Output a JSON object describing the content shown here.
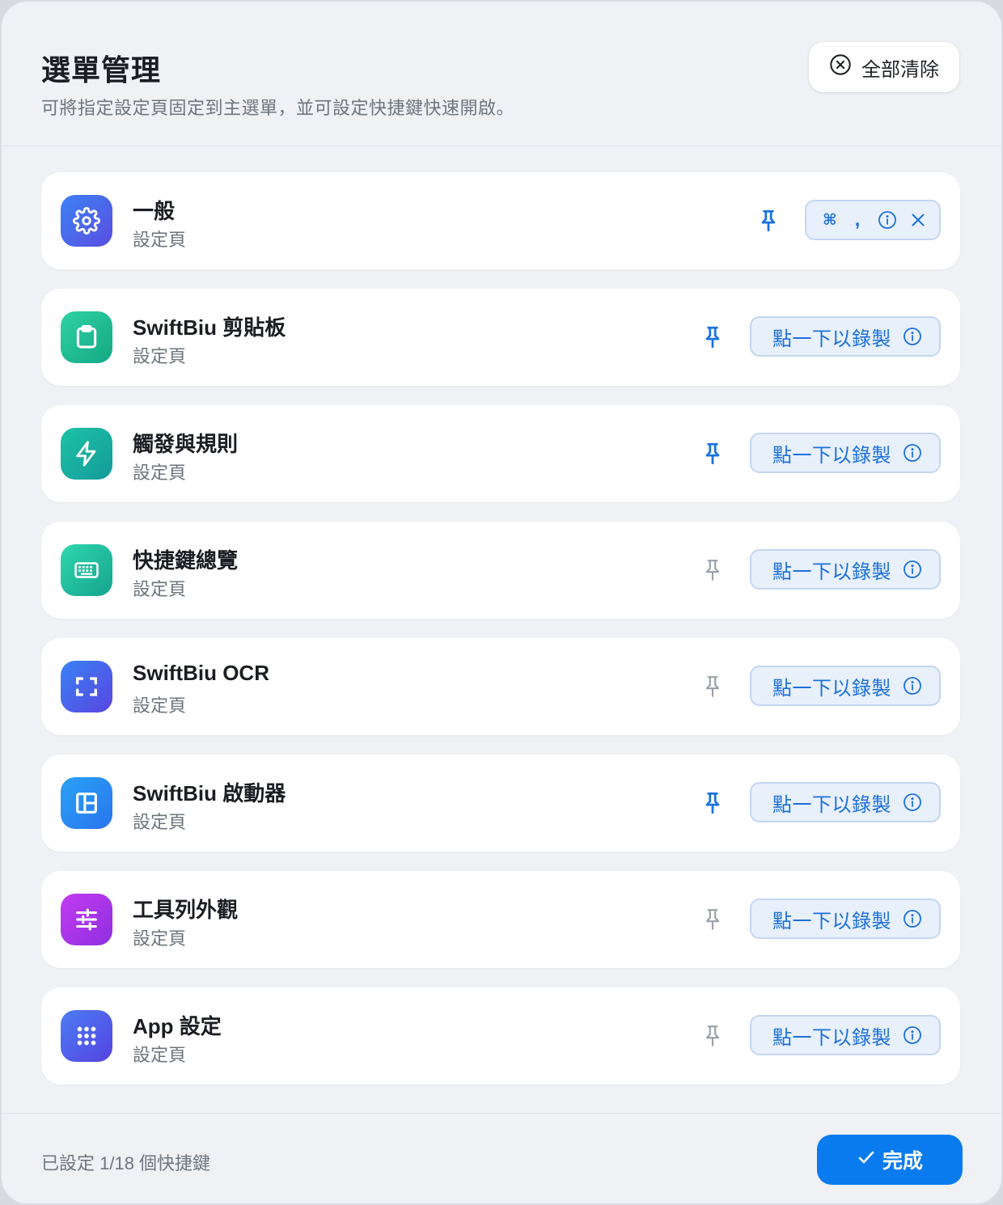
{
  "header": {
    "title": "選單管理",
    "subtitle": "可將指定設定頁固定到主選單，並可設定快捷鍵快速開啟。",
    "clear_all_label": "全部清除"
  },
  "items": [
    {
      "name": "一般",
      "sub": "設定頁",
      "icon": "gear-icon",
      "color_from": "#3b82f6",
      "color_to": "#5b4ee0",
      "pinned": true,
      "shortcut_key": "⌘",
      "shortcut_sep": ","
    },
    {
      "name": "SwiftBiu 剪貼板",
      "sub": "設定頁",
      "icon": "clipboard-icon",
      "color_from": "#2fd2a4",
      "color_to": "#14a884",
      "pinned": true,
      "record_label": "點一下以錄製"
    },
    {
      "name": "觸發與規則",
      "sub": "設定頁",
      "icon": "lightning-icon",
      "color_from": "#1cc3a5",
      "color_to": "#159a9a",
      "pinned": true,
      "record_label": "點一下以錄製"
    },
    {
      "name": "快捷鍵總覽",
      "sub": "設定頁",
      "icon": "keyboard-icon",
      "color_from": "#2fd6ad",
      "color_to": "#16a48d",
      "pinned": false,
      "record_label": "點一下以錄製"
    },
    {
      "name": "SwiftBiu OCR",
      "sub": "設定頁",
      "icon": "scan-icon",
      "color_from": "#3a82f6",
      "color_to": "#5845df",
      "pinned": false,
      "record_label": "點一下以錄製"
    },
    {
      "name": "SwiftBiu 啟動器",
      "sub": "設定頁",
      "icon": "layout-icon",
      "color_from": "#2aa2f6",
      "color_to": "#2a74ee",
      "pinned": true,
      "record_label": "點一下以錄製"
    },
    {
      "name": "工具列外觀",
      "sub": "設定頁",
      "icon": "sliders-icon",
      "color_from": "#c23bf0",
      "color_to": "#8f2fe0",
      "pinned": false,
      "record_label": "點一下以錄製"
    },
    {
      "name": "App 設定",
      "sub": "設定頁",
      "icon": "grid-dots-icon",
      "color_from": "#4c7df4",
      "color_to": "#5443e0",
      "pinned": false,
      "record_label": "點一下以錄製"
    }
  ],
  "footer": {
    "status": "已設定 1/18 個快捷鍵",
    "done_label": "完成"
  },
  "colors": {
    "accent": "#0a7bef",
    "pin_active": "#1a73e0",
    "pin_inactive": "#9aa0a8"
  }
}
